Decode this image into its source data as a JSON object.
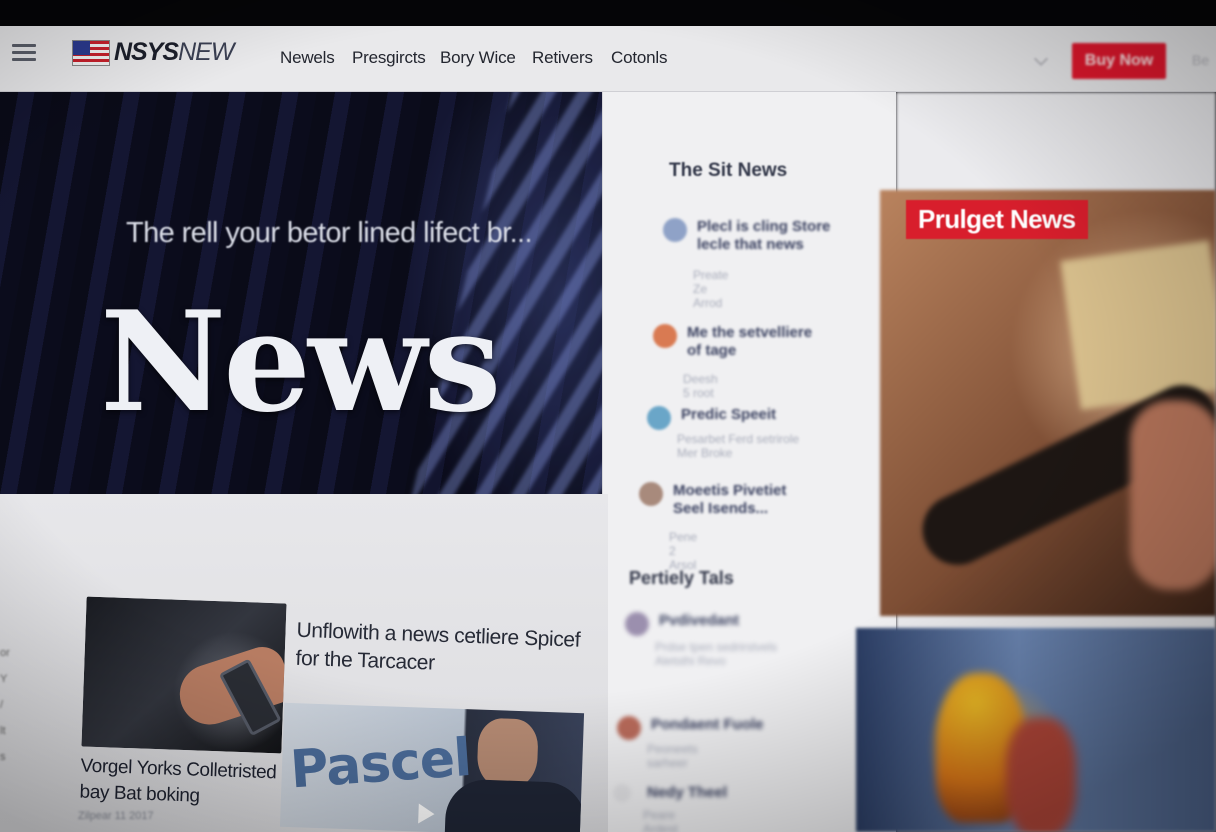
{
  "site": {
    "logo_bold": "NSYS",
    "logo_thin": "NEW"
  },
  "nav": {
    "links": [
      "Newels",
      "Presgircts",
      "Bory Wice",
      "Retivers",
      "Cotonls"
    ],
    "subscribe_label": "Buy Now",
    "more_label": "Be"
  },
  "hero": {
    "subtitle": "The rell your betor lined lifect br...",
    "title": "News"
  },
  "sidebar": {
    "heading": "The Sit News",
    "items": [
      {
        "title": "Plecl is cling Store lecle that news",
        "meta": "Preate Ze Arrod",
        "avatar_color": "#8fa2c7"
      },
      {
        "title": "Me the setvelliere of tage",
        "meta": "Deesh 5 root",
        "avatar_color": "#d97a52"
      },
      {
        "title": "Predic Speeit",
        "meta": "Pesarbet Ferd setrirole Mer Broke",
        "avatar_color": "#6aa6c8"
      },
      {
        "title": "Moeetis Pivetiet Seel Isends...",
        "meta": "Pene 2 Arsol",
        "avatar_color": "#a88a7c"
      }
    ],
    "heading2": "Pertiely Tals",
    "items2": [
      {
        "title": "Pvdivedant",
        "meta": "Prdse tpen sedrirstvels Aletsthi Revo",
        "avatar_color": "#9b8fae"
      },
      {
        "title": "Pondaent Fuole",
        "meta": "Peoneets sarheer",
        "avatar_color": "#b86a5a"
      },
      {
        "title": "Nedy Theel",
        "meta": "Peare Ardest",
        "avatar_color": "#e3e3e6"
      }
    ]
  },
  "articles": {
    "lead_title": "Unflowith a news cetliere Spicef for the Tarcacer",
    "second_caption": "Vorgel Yorks Colletristed bay Bat boking",
    "second_meta": "Zilpear 11 2017",
    "sign_text": "Pascel"
  },
  "featured": {
    "label": "Prulget News"
  },
  "left_edge": {
    "fragments": [
      "or",
      "Y",
      "/",
      "lt",
      "s"
    ]
  },
  "colors": {
    "accent_red": "#e3172d",
    "nav_bg": "#e9e9eb",
    "hero_bg": "#0b0c18"
  },
  "icons": {
    "menu": "hamburger-icon",
    "flag": "us-flag-icon",
    "play": "play-icon"
  }
}
